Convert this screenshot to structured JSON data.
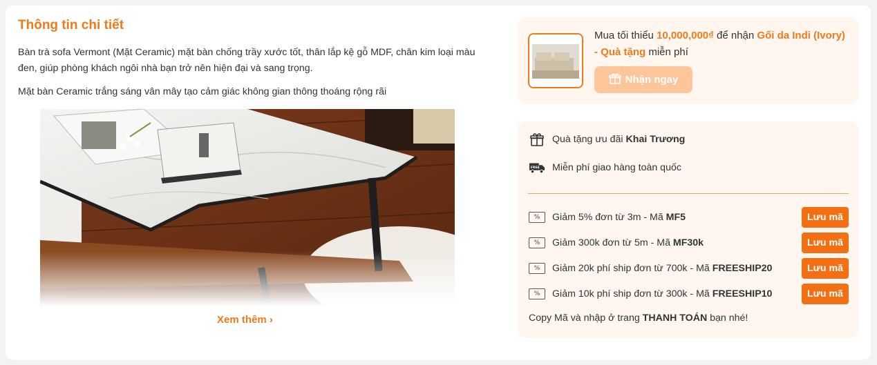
{
  "details": {
    "title": "Thông tin chi tiết",
    "description_1": "Bàn trà sofa Vermont (Mặt Ceramic) mặt bàn chống trầy xước tốt, thân lắp kệ gỗ MDF, chân kim loại màu đen, giúp phòng khách ngôi nhà bạn trở nên hiện đại và sang trọng.",
    "description_2": "Mặt bàn Ceramic trắng sáng vân mây tạo cảm giác không gian thông thoáng rộng rãi",
    "see_more": "Xem thêm ›"
  },
  "gift": {
    "prefix": "Mua tối thiểu ",
    "min_amount": "10,000,000₫",
    "middle": " để nhận ",
    "gift_name": "Gối da Indi (Ivory) - Quà tặng",
    "suffix": " miễn phí",
    "claim_label": "Nhận ngay"
  },
  "perks": [
    {
      "icon": "gift-icon",
      "text": "Quà tặng ưu đãi ",
      "bold": "Khai Trương"
    },
    {
      "icon": "delivery-truck-icon",
      "text": "Miễn phí giao hàng toàn quốc",
      "bold": ""
    }
  ],
  "coupons": [
    {
      "text": "Giảm 5% đơn từ 3m - Mã ",
      "code": "MF5",
      "button": "Lưu mã"
    },
    {
      "text": "Giảm 300k đơn từ 5m - Mã ",
      "code": "MF30k",
      "button": "Lưu mã"
    },
    {
      "text": "Giảm 20k phí ship đơn từ 700k - Mã ",
      "code": "FREESHIP20",
      "button": "Lưu mã"
    },
    {
      "text": "Giảm 10k phí ship đơn từ 300k - Mã ",
      "code": "FREESHIP10",
      "button": "Lưu mã"
    }
  ],
  "note": {
    "prefix": "Copy Mã và nhập ở trang ",
    "bold": "THANH TOÁN",
    "suffix": " bạn nhé!"
  },
  "colors": {
    "accent": "#f07a1a",
    "button": "#f27013",
    "button_disabled": "#fcc59a",
    "panel_bg": "#fff6f0"
  }
}
